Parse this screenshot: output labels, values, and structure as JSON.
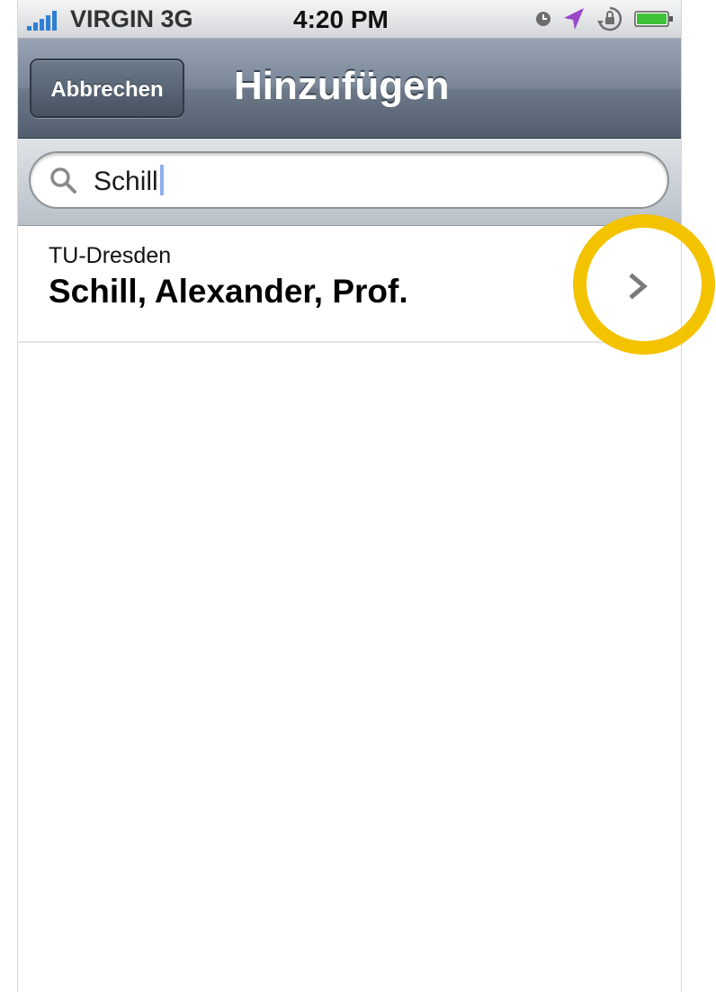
{
  "status_bar": {
    "carrier": "VIRGIN 3G",
    "time": "4:20 PM",
    "icons": [
      "signal-bars-icon",
      "clock-icon",
      "location-arrow-icon",
      "orientation-lock-icon",
      "battery-icon"
    ]
  },
  "nav_bar": {
    "back_label": "Abbrechen",
    "title": "Hinzufügen"
  },
  "search": {
    "value": "Schill",
    "icon": "search-icon"
  },
  "results": [
    {
      "subtitle": "TU-Dresden",
      "title": "Schill, Alexander, Prof.",
      "accessory": "chevron-right-icon"
    }
  ],
  "colors": {
    "nav_bar": "#6b7888",
    "highlight_ring": "#f4c300",
    "location_arrow": "#9a47c9",
    "battery": "#3ec23a"
  }
}
